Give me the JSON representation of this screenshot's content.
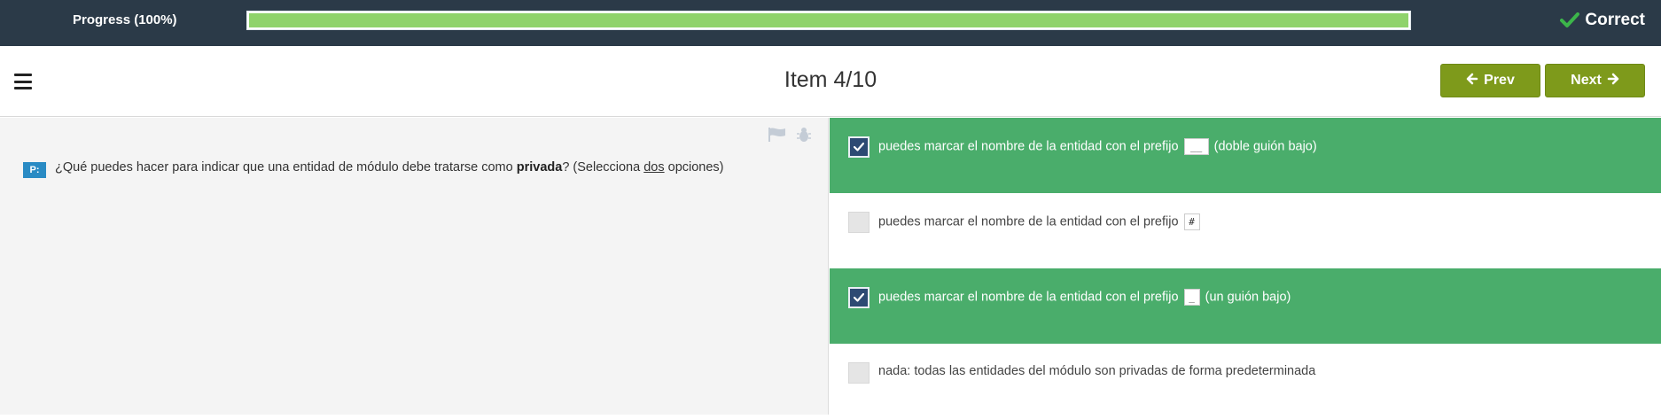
{
  "progress": {
    "label": "Progress (100%)",
    "value_percent": 100
  },
  "status": {
    "label": "Correct",
    "icon": "check-icon"
  },
  "header": {
    "title": "Item 4/10",
    "prev_label": "Prev",
    "next_label": "Next"
  },
  "question": {
    "badge": "P:",
    "text_before": "¿Qué puedes hacer para indicar que una entidad de módulo debe tratarse como ",
    "bold": "privada",
    "text_middle": "? (Selecciona ",
    "underlined": "dos",
    "text_after": " opciones)"
  },
  "options": [
    {
      "checked": true,
      "text_before": "puedes marcar el nombre de la entidad con el prefijo",
      "code": "__",
      "text_after": "(doble guión bajo)"
    },
    {
      "checked": false,
      "text_before": "puedes marcar el nombre de la entidad con el prefijo",
      "code": "#",
      "text_after": ""
    },
    {
      "checked": true,
      "text_before": "puedes marcar el nombre de la entidad con el prefijo",
      "code": "_",
      "text_after": "(un guión bajo)"
    },
    {
      "checked": false,
      "text_before": "nada: todas las entidades del módulo son privadas de forma predeterminada",
      "code": "",
      "text_after": ""
    }
  ],
  "colors": {
    "topbar": "#2b3a48",
    "progress": "#8fd36b",
    "accent": "#7e9a1b",
    "selected": "#4aad6b",
    "checkbox": "#2d4a73",
    "badge": "#2a8bc4"
  }
}
